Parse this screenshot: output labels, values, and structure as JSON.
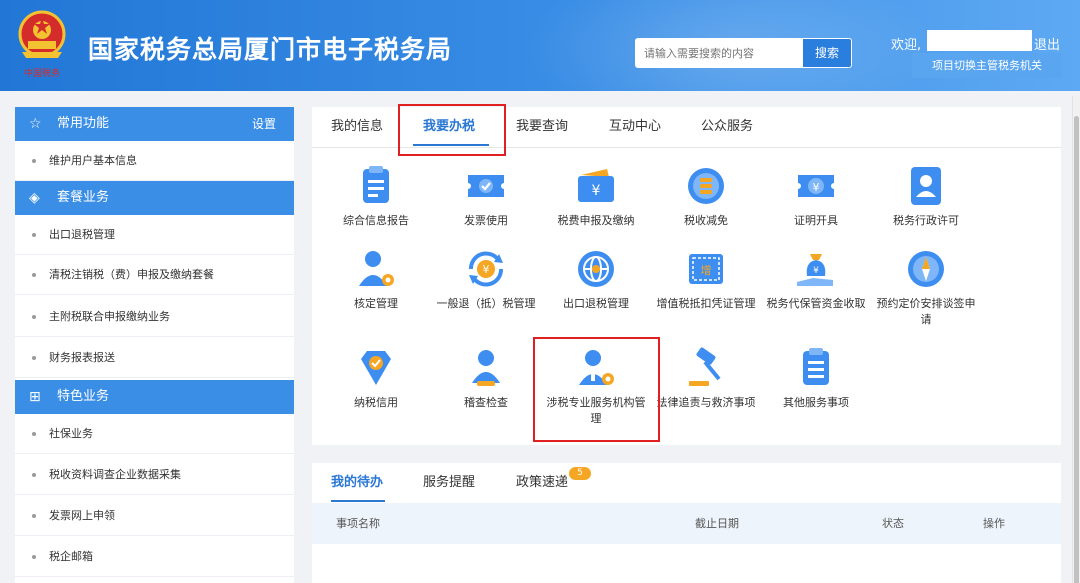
{
  "header": {
    "site_title": "国家税务总局厦门市电子税务局",
    "search_placeholder": "请输入需要搜索的内容",
    "search_button": "搜索",
    "welcome": "欢迎,",
    "logout": "退出",
    "switch_authority": "项目切换主管税务机关",
    "brand_color": "#2277d6"
  },
  "sidebar": {
    "common": {
      "title": "常用功能",
      "settings": "设置",
      "items": [
        "维护用户基本信息"
      ]
    },
    "package": {
      "title": "套餐业务",
      "items": [
        "出口退税管理",
        "清税注销税（费）申报及缴纳套餐",
        "主附税联合申报缴纳业务",
        "财务报表报送"
      ]
    },
    "special": {
      "title": "特色业务",
      "items": [
        "社保业务",
        "税收资料调查企业数据采集",
        "发票网上申领",
        "税企邮箱"
      ]
    }
  },
  "main_tabs": [
    "我的信息",
    "我要办税",
    "我要查询",
    "互动中心",
    "公众服务"
  ],
  "active_tab": "我要办税",
  "services": [
    {
      "label": "综合信息报告",
      "icon": "report-clipboard-icon"
    },
    {
      "label": "发票使用",
      "icon": "invoice-ticket-icon"
    },
    {
      "label": "税费申报及缴纳",
      "icon": "wallet-yuan-icon"
    },
    {
      "label": "税收减免",
      "icon": "coin-stack-icon"
    },
    {
      "label": "证明开具",
      "icon": "certificate-yuan-icon"
    },
    {
      "label": "税务行政许可",
      "icon": "id-card-icon"
    },
    {
      "label": "核定管理",
      "icon": "user-gear-icon"
    },
    {
      "label": "一般退（抵）税管理",
      "icon": "refund-cycle-icon"
    },
    {
      "label": "出口退税管理",
      "icon": "globe-icon"
    },
    {
      "label": "增值税抵扣凭证管理",
      "icon": "vat-voucher-icon"
    },
    {
      "label": "税务代保管资金收取",
      "icon": "money-bag-hand-icon"
    },
    {
      "label": "预约定价安排谈签申请",
      "icon": "compass-icon"
    },
    {
      "label": "纳税信用",
      "icon": "diamond-check-icon"
    },
    {
      "label": "稽查检查",
      "icon": "inspector-person-icon"
    },
    {
      "label": "涉税专业服务机构管理",
      "icon": "agency-person-gear-icon"
    },
    {
      "label": "法律追责与救济事项",
      "icon": "gavel-icon"
    },
    {
      "label": "其他服务事项",
      "icon": "list-document-icon"
    }
  ],
  "todo": {
    "tabs": [
      "我的待办",
      "服务提醒",
      "政策速递"
    ],
    "badge": "5",
    "columns": [
      "事项名称",
      "截止日期",
      "状态",
      "操作"
    ]
  }
}
